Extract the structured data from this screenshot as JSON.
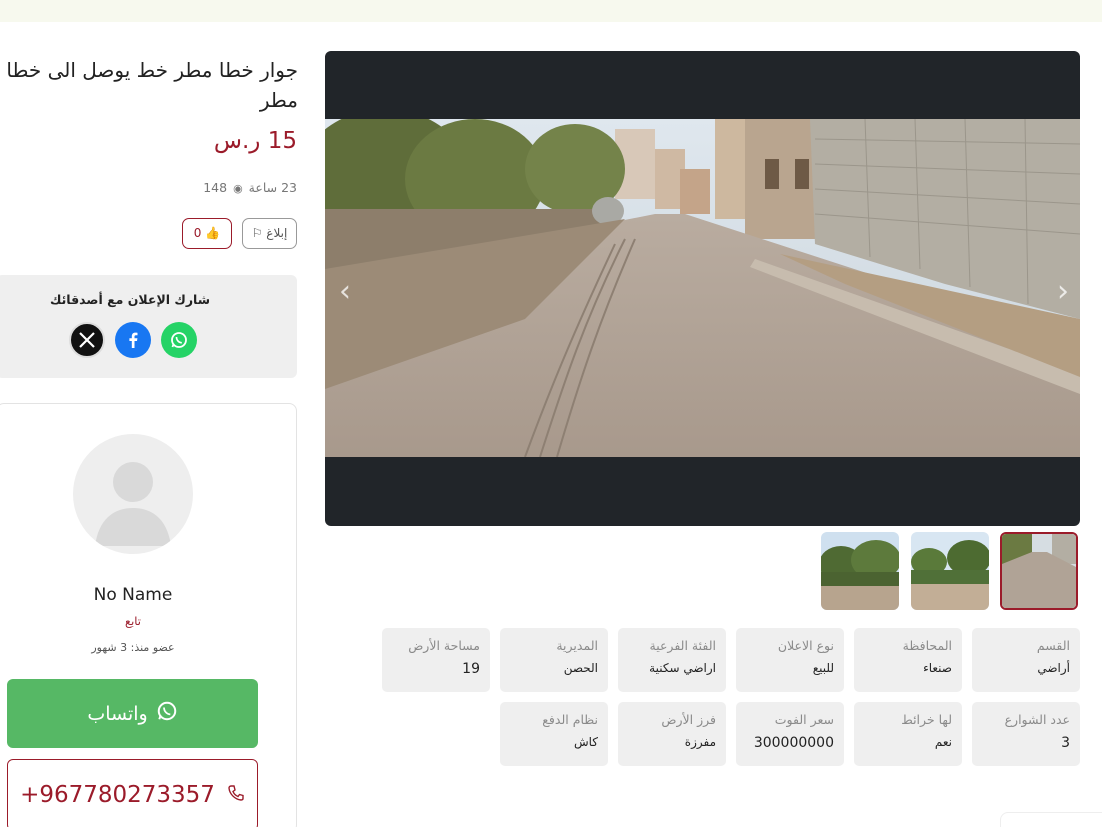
{
  "listing": {
    "title": "جوار خطا مطر خط يوصل الى خطا مطر",
    "price": "15 ر.س",
    "posted": "23 ساعة",
    "views": "148",
    "report_label": "إبلاغ",
    "likes": "0"
  },
  "share": {
    "title": "شارك الإعلان مع أصدقائك",
    "icons": [
      "x-icon",
      "facebook-icon",
      "whatsapp-icon"
    ]
  },
  "seller": {
    "name": "No Name",
    "role": "تابع",
    "member_since": "عضو منذ: 3 شهور",
    "whatsapp_label": "واتساب",
    "phone": "+967780273357"
  },
  "specs": [
    {
      "label": "القسم",
      "value": "أراضي"
    },
    {
      "label": "المحافظة",
      "value": "صنعاء"
    },
    {
      "label": "نوع الاعلان",
      "value": "للبيع"
    },
    {
      "label": "الفئة الفرعية",
      "value": "اراضي سكنية"
    },
    {
      "label": "المديرية",
      "value": "الحصن"
    },
    {
      "label": "مساحة الأرض",
      "value": "19"
    },
    {
      "label": "عدد الشوارع",
      "value": "3"
    },
    {
      "label": "لها خرائط",
      "value": "نعم"
    },
    {
      "label": "سعر الفوت",
      "value": "300000000"
    },
    {
      "label": "فرز الأرض",
      "value": "مفرزة"
    },
    {
      "label": "نظام الدفع",
      "value": "كاش"
    }
  ],
  "colors": {
    "accent": "#9b1b2a",
    "whatsapp": "#56b865",
    "card_bg": "#efefef",
    "gallery_bg": "#212529"
  }
}
